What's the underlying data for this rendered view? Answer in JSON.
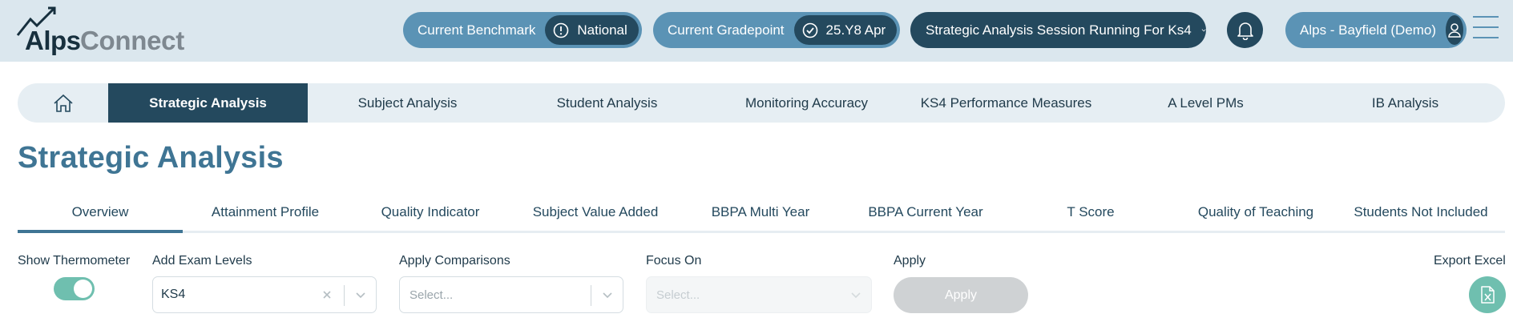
{
  "header": {
    "logo_part1": "Alps",
    "logo_part2": "Connect",
    "benchmark_label": "Current Benchmark",
    "benchmark_value": "National",
    "gradepoint_label": "Current Gradepoint",
    "gradepoint_value": "25.Y8 Apr",
    "session_label": "Strategic Analysis Session Running For Ks4",
    "user_label": "Alps - Bayfield (Demo)"
  },
  "mainnav": {
    "items": [
      "Strategic Analysis",
      "Subject Analysis",
      "Student Analysis",
      "Monitoring Accuracy",
      "KS4 Performance Measures",
      "A Level PMs",
      "IB Analysis"
    ],
    "active_index": 0
  },
  "page_title": "Strategic Analysis",
  "subtabs": {
    "items": [
      "Overview",
      "Attainment Profile",
      "Quality Indicator",
      "Subject Value Added",
      "BBPA Multi Year",
      "BBPA Current Year",
      "T Score",
      "Quality of Teaching",
      "Students Not Included"
    ],
    "active_index": 0
  },
  "filters": {
    "show_thermometer_label": "Show Thermometer",
    "show_thermometer_on": true,
    "exam_levels_label": "Add Exam Levels",
    "exam_levels_value": "KS4",
    "comparisons_label": "Apply Comparisons",
    "comparisons_placeholder": "Select...",
    "focus_label": "Focus On",
    "focus_placeholder": "Select...",
    "apply_label": "Apply",
    "apply_button": "Apply",
    "export_label": "Export Excel"
  },
  "icons": {
    "benchmark": "info-circle-icon",
    "gradepoint": "check-circle-icon",
    "session": "chevron-down-icon",
    "bell": "bell-icon",
    "user": "user-icon",
    "menu": "hamburger-icon",
    "home": "home-icon",
    "export": "excel-file-icon"
  },
  "colors": {
    "header_bg": "#dbe7ee",
    "primary_dark": "#24495e",
    "primary_light": "#5b93b5",
    "title": "#3f7594",
    "accent_green": "#6fbfaf"
  }
}
